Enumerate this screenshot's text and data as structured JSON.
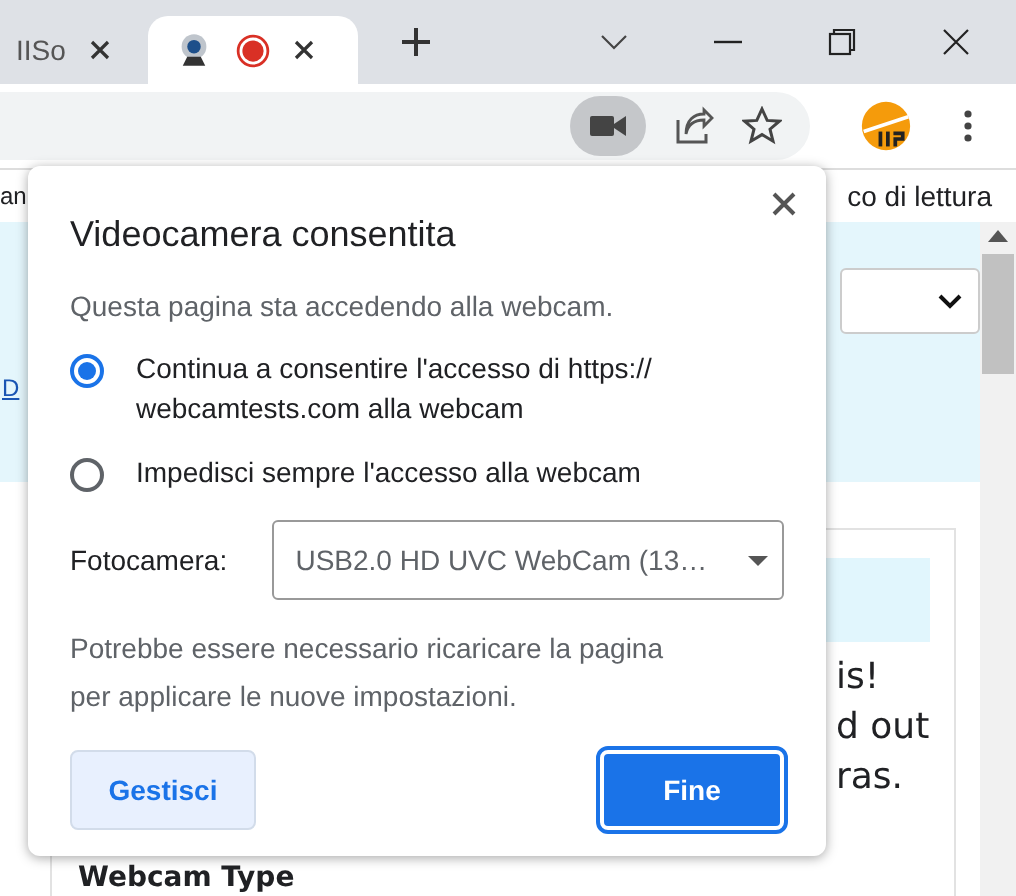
{
  "tabs": [
    {
      "kind": "text",
      "label": "IISo",
      "selected": false
    },
    {
      "kind": "media",
      "recording": true,
      "selected": true
    }
  ],
  "bookmarks": {
    "left": "an",
    "right": "co di lettura"
  },
  "page": {
    "link": "D",
    "lines": [
      "is!",
      "d out",
      "ras."
    ],
    "heading": "Webcam Type"
  },
  "popup": {
    "title": "Videocamera consentita",
    "subtitle": "Questa pagina sta accedendo alla webcam.",
    "options": [
      {
        "label": "Continua a consentire l'accesso di https:// webcamtests.com alla webcam",
        "selected": true
      },
      {
        "label": "Impedisci sempre l'accesso alla webcam",
        "selected": false
      }
    ],
    "camera": {
      "label": "Fotocamera:",
      "value": "USB2.0 HD UVC WebCam (13…"
    },
    "note": "Potrebbe essere necessario ricaricare la pagina per applicare le nuove impostazioni.",
    "buttons": [
      {
        "label": "Gestisci",
        "kind": "secondary"
      },
      {
        "label": "Fine",
        "kind": "primary"
      }
    ]
  }
}
